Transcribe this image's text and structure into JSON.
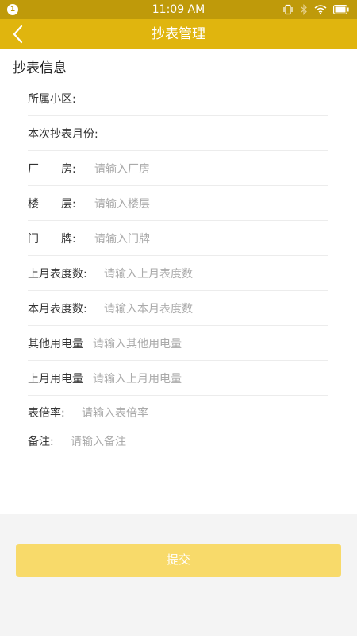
{
  "status_bar": {
    "notification_badge": "1",
    "time": "11:09 AM"
  },
  "app_bar": {
    "title": "抄表管理"
  },
  "form": {
    "section_title": "抄表信息",
    "fields": [
      {
        "label": "所属小区:",
        "placeholder": ""
      },
      {
        "label": "本次抄表月份:",
        "placeholder": ""
      },
      {
        "label": "厂　　房:",
        "placeholder": "请输入厂房"
      },
      {
        "label": "楼　　层:",
        "placeholder": "请输入楼层"
      },
      {
        "label": "门　　牌:",
        "placeholder": "请输入门牌"
      },
      {
        "label": "上月表度数:",
        "placeholder": "请输入上月表度数"
      },
      {
        "label": "本月表度数:",
        "placeholder": "请输入本月表度数"
      },
      {
        "label": "其他用电量",
        "placeholder": "请输入其他用电量"
      },
      {
        "label": "上月用电量",
        "placeholder": "请输入上月用电量"
      },
      {
        "label": "表倍率:",
        "placeholder": "请输入表倍率"
      },
      {
        "label": "备注:",
        "placeholder": "请输入备注"
      }
    ]
  },
  "footer": {
    "submit_label": "提交"
  },
  "colors": {
    "status_bar": "#bf9a0a",
    "app_bar": "#e0b50e",
    "submit_button": "#f8da6a"
  },
  "icons": {
    "back": "chevron-left-icon",
    "vibrate": "vibrate-icon",
    "bluetooth": "bluetooth-icon",
    "wifi": "wifi-icon",
    "battery": "battery-icon"
  }
}
